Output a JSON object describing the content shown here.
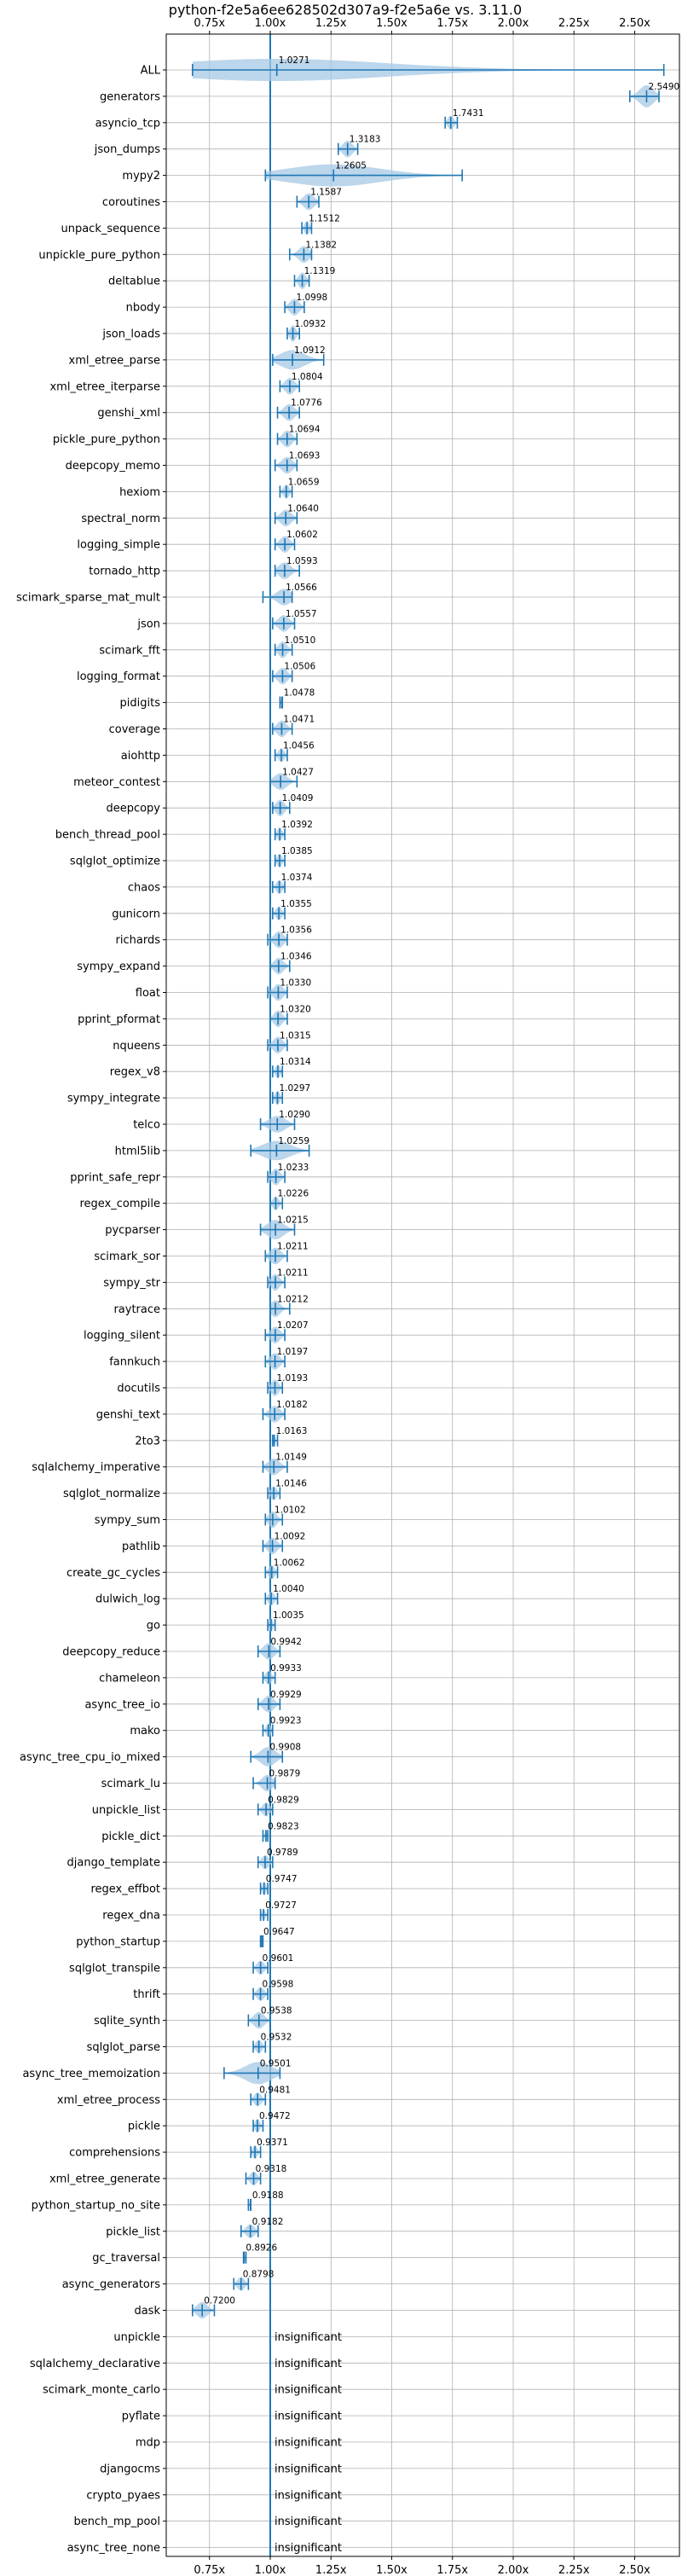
{
  "chart_data": {
    "type": "violin",
    "title": "python-f2e5a6ee628502d307a9-f2e5a6e vs. 3.11.0",
    "xlim": [
      0.6,
      2.75
    ],
    "xticks": [
      0.75,
      1.0,
      1.25,
      1.5,
      1.75,
      2.0,
      2.25,
      2.5
    ],
    "xtick_labels": [
      "0.75x",
      "1.00x",
      "1.25x",
      "1.50x",
      "1.75x",
      "2.00x",
      "2.25x",
      "2.50x"
    ],
    "grid": true,
    "reference_line": 1.0,
    "significant": [
      {
        "name": "ALL",
        "mean": 1.0271,
        "min": 0.68,
        "max": 2.62,
        "spread": 0.06
      },
      {
        "name": "generators",
        "mean": 2.549,
        "min": 2.48,
        "max": 2.6,
        "spread": 0.05
      },
      {
        "name": "asyncio_tcp",
        "mean": 1.7431,
        "min": 1.72,
        "max": 1.77,
        "spread": 0.02
      },
      {
        "name": "json_dumps",
        "mean": 1.3183,
        "min": 1.28,
        "max": 1.36,
        "spread": 0.03
      },
      {
        "name": "mypy2",
        "mean": 1.2605,
        "min": 0.98,
        "max": 1.79,
        "spread": 0.12
      },
      {
        "name": "coroutines",
        "mean": 1.1587,
        "min": 1.11,
        "max": 1.2,
        "spread": 0.03
      },
      {
        "name": "unpack_sequence",
        "mean": 1.1512,
        "min": 1.13,
        "max": 1.17,
        "spread": 0.02
      },
      {
        "name": "unpickle_pure_python",
        "mean": 1.1382,
        "min": 1.08,
        "max": 1.17,
        "spread": 0.03
      },
      {
        "name": "deltablue",
        "mean": 1.1319,
        "min": 1.1,
        "max": 1.16,
        "spread": 0.03
      },
      {
        "name": "nbody",
        "mean": 1.0998,
        "min": 1.06,
        "max": 1.14,
        "spread": 0.03
      },
      {
        "name": "json_loads",
        "mean": 1.0932,
        "min": 1.07,
        "max": 1.12,
        "spread": 0.03
      },
      {
        "name": "xml_etree_parse",
        "mean": 1.0912,
        "min": 1.01,
        "max": 1.22,
        "spread": 0.04
      },
      {
        "name": "xml_etree_iterparse",
        "mean": 1.0804,
        "min": 1.04,
        "max": 1.12,
        "spread": 0.03
      },
      {
        "name": "genshi_xml",
        "mean": 1.0776,
        "min": 1.03,
        "max": 1.12,
        "spread": 0.03
      },
      {
        "name": "pickle_pure_python",
        "mean": 1.0694,
        "min": 1.03,
        "max": 1.11,
        "spread": 0.03
      },
      {
        "name": "deepcopy_memo",
        "mean": 1.0693,
        "min": 1.02,
        "max": 1.11,
        "spread": 0.03
      },
      {
        "name": "hexiom",
        "mean": 1.0659,
        "min": 1.04,
        "max": 1.09,
        "spread": 0.02
      },
      {
        "name": "spectral_norm",
        "mean": 1.064,
        "min": 1.02,
        "max": 1.11,
        "spread": 0.03
      },
      {
        "name": "logging_simple",
        "mean": 1.0602,
        "min": 1.02,
        "max": 1.1,
        "spread": 0.03
      },
      {
        "name": "tornado_http",
        "mean": 1.0593,
        "min": 1.02,
        "max": 1.12,
        "spread": 0.03
      },
      {
        "name": "scimark_sparse_mat_mult",
        "mean": 1.0566,
        "min": 0.97,
        "max": 1.09,
        "spread": 0.03
      },
      {
        "name": "json",
        "mean": 1.0557,
        "min": 1.01,
        "max": 1.1,
        "spread": 0.03
      },
      {
        "name": "scimark_fft",
        "mean": 1.051,
        "min": 1.02,
        "max": 1.09,
        "spread": 0.03
      },
      {
        "name": "logging_format",
        "mean": 1.0506,
        "min": 1.01,
        "max": 1.09,
        "spread": 0.03
      },
      {
        "name": "pidigits",
        "mean": 1.0478,
        "min": 1.04,
        "max": 1.05,
        "spread": 0.01
      },
      {
        "name": "coverage",
        "mean": 1.0471,
        "min": 1.01,
        "max": 1.09,
        "spread": 0.03
      },
      {
        "name": "aiohttp",
        "mean": 1.0456,
        "min": 1.02,
        "max": 1.07,
        "spread": 0.02
      },
      {
        "name": "meteor_contest",
        "mean": 1.0427,
        "min": 1.0,
        "max": 1.11,
        "spread": 0.03
      },
      {
        "name": "deepcopy",
        "mean": 1.0409,
        "min": 1.01,
        "max": 1.08,
        "spread": 0.03
      },
      {
        "name": "bench_thread_pool",
        "mean": 1.0392,
        "min": 1.02,
        "max": 1.06,
        "spread": 0.02
      },
      {
        "name": "sqlglot_optimize",
        "mean": 1.0385,
        "min": 1.02,
        "max": 1.06,
        "spread": 0.02
      },
      {
        "name": "chaos",
        "mean": 1.0374,
        "min": 1.01,
        "max": 1.06,
        "spread": 0.02
      },
      {
        "name": "gunicorn",
        "mean": 1.0355,
        "min": 1.01,
        "max": 1.06,
        "spread": 0.02
      },
      {
        "name": "richards",
        "mean": 1.0356,
        "min": 0.99,
        "max": 1.07,
        "spread": 0.03
      },
      {
        "name": "sympy_expand",
        "mean": 1.0346,
        "min": 1.0,
        "max": 1.08,
        "spread": 0.03
      },
      {
        "name": "float",
        "mean": 1.033,
        "min": 0.99,
        "max": 1.07,
        "spread": 0.03
      },
      {
        "name": "pprint_pformat",
        "mean": 1.032,
        "min": 1.0,
        "max": 1.07,
        "spread": 0.03
      },
      {
        "name": "nqueens",
        "mean": 1.0315,
        "min": 0.99,
        "max": 1.07,
        "spread": 0.03
      },
      {
        "name": "regex_v8",
        "mean": 1.0314,
        "min": 1.01,
        "max": 1.05,
        "spread": 0.02
      },
      {
        "name": "sympy_integrate",
        "mean": 1.0297,
        "min": 1.01,
        "max": 1.05,
        "spread": 0.02
      },
      {
        "name": "telco",
        "mean": 1.029,
        "min": 0.96,
        "max": 1.1,
        "spread": 0.03
      },
      {
        "name": "html5lib",
        "mean": 1.0259,
        "min": 0.92,
        "max": 1.16,
        "spread": 0.04
      },
      {
        "name": "pprint_safe_repr",
        "mean": 1.0233,
        "min": 0.99,
        "max": 1.06,
        "spread": 0.03
      },
      {
        "name": "regex_compile",
        "mean": 1.0226,
        "min": 1.0,
        "max": 1.05,
        "spread": 0.02
      },
      {
        "name": "pycparser",
        "mean": 1.0215,
        "min": 0.96,
        "max": 1.1,
        "spread": 0.04
      },
      {
        "name": "scimark_sor",
        "mean": 1.0211,
        "min": 0.98,
        "max": 1.07,
        "spread": 0.03
      },
      {
        "name": "sympy_str",
        "mean": 1.0211,
        "min": 0.99,
        "max": 1.06,
        "spread": 0.03
      },
      {
        "name": "raytrace",
        "mean": 1.0212,
        "min": 1.0,
        "max": 1.08,
        "spread": 0.03
      },
      {
        "name": "logging_silent",
        "mean": 1.0207,
        "min": 0.98,
        "max": 1.06,
        "spread": 0.03
      },
      {
        "name": "fannkuch",
        "mean": 1.0197,
        "min": 0.98,
        "max": 1.06,
        "spread": 0.03
      },
      {
        "name": "docutils",
        "mean": 1.0193,
        "min": 0.99,
        "max": 1.05,
        "spread": 0.03
      },
      {
        "name": "genshi_text",
        "mean": 1.0182,
        "min": 0.97,
        "max": 1.06,
        "spread": 0.03
      },
      {
        "name": "2to3",
        "mean": 1.0163,
        "min": 1.01,
        "max": 1.03,
        "spread": 0.01
      },
      {
        "name": "sqlalchemy_imperative",
        "mean": 1.0149,
        "min": 0.97,
        "max": 1.07,
        "spread": 0.03
      },
      {
        "name": "sqlglot_normalize",
        "mean": 1.0146,
        "min": 0.99,
        "max": 1.04,
        "spread": 0.02
      },
      {
        "name": "sympy_sum",
        "mean": 1.0102,
        "min": 0.98,
        "max": 1.05,
        "spread": 0.03
      },
      {
        "name": "pathlib",
        "mean": 1.0092,
        "min": 0.97,
        "max": 1.05,
        "spread": 0.03
      },
      {
        "name": "create_gc_cycles",
        "mean": 1.0062,
        "min": 0.98,
        "max": 1.03,
        "spread": 0.02
      },
      {
        "name": "dulwich_log",
        "mean": 1.004,
        "min": 0.98,
        "max": 1.03,
        "spread": 0.02
      },
      {
        "name": "go",
        "mean": 1.0035,
        "min": 0.99,
        "max": 1.02,
        "spread": 0.02
      },
      {
        "name": "deepcopy_reduce",
        "mean": 0.9942,
        "min": 0.95,
        "max": 1.04,
        "spread": 0.03
      },
      {
        "name": "chameleon",
        "mean": 0.9933,
        "min": 0.97,
        "max": 1.02,
        "spread": 0.02
      },
      {
        "name": "async_tree_io",
        "mean": 0.9929,
        "min": 0.95,
        "max": 1.04,
        "spread": 0.03
      },
      {
        "name": "mako",
        "mean": 0.9923,
        "min": 0.97,
        "max": 1.01,
        "spread": 0.02
      },
      {
        "name": "async_tree_cpu_io_mixed",
        "mean": 0.9908,
        "min": 0.92,
        "max": 1.05,
        "spread": 0.04
      },
      {
        "name": "scimark_lu",
        "mean": 0.9879,
        "min": 0.93,
        "max": 1.02,
        "spread": 0.03
      },
      {
        "name": "unpickle_list",
        "mean": 0.9829,
        "min": 0.95,
        "max": 1.01,
        "spread": 0.02
      },
      {
        "name": "pickle_dict",
        "mean": 0.9823,
        "min": 0.97,
        "max": 0.99,
        "spread": 0.01
      },
      {
        "name": "django_template",
        "mean": 0.9789,
        "min": 0.95,
        "max": 1.01,
        "spread": 0.02
      },
      {
        "name": "regex_effbot",
        "mean": 0.9747,
        "min": 0.96,
        "max": 0.99,
        "spread": 0.02
      },
      {
        "name": "regex_dna",
        "mean": 0.9727,
        "min": 0.96,
        "max": 0.99,
        "spread": 0.01
      },
      {
        "name": "python_startup",
        "mean": 0.9647,
        "min": 0.96,
        "max": 0.97,
        "spread": 0.01
      },
      {
        "name": "sqlglot_transpile",
        "mean": 0.9601,
        "min": 0.93,
        "max": 0.99,
        "spread": 0.02
      },
      {
        "name": "thrift",
        "mean": 0.9598,
        "min": 0.93,
        "max": 0.99,
        "spread": 0.02
      },
      {
        "name": "sqlite_synth",
        "mean": 0.9538,
        "min": 0.91,
        "max": 1.0,
        "spread": 0.03
      },
      {
        "name": "sqlglot_parse",
        "mean": 0.9532,
        "min": 0.93,
        "max": 0.98,
        "spread": 0.02
      },
      {
        "name": "async_tree_memoization",
        "mean": 0.9501,
        "min": 0.81,
        "max": 1.04,
        "spread": 0.05
      },
      {
        "name": "xml_etree_process",
        "mean": 0.9481,
        "min": 0.92,
        "max": 0.98,
        "spread": 0.02
      },
      {
        "name": "pickle",
        "mean": 0.9472,
        "min": 0.93,
        "max": 0.97,
        "spread": 0.02
      },
      {
        "name": "comprehensions",
        "mean": 0.9371,
        "min": 0.92,
        "max": 0.96,
        "spread": 0.02
      },
      {
        "name": "xml_etree_generate",
        "mean": 0.9318,
        "min": 0.9,
        "max": 0.96,
        "spread": 0.02
      },
      {
        "name": "python_startup_no_site",
        "mean": 0.9188,
        "min": 0.91,
        "max": 0.92,
        "spread": 0.01
      },
      {
        "name": "pickle_list",
        "mean": 0.9182,
        "min": 0.88,
        "max": 0.95,
        "spread": 0.02
      },
      {
        "name": "gc_traversal",
        "mean": 0.8926,
        "min": 0.89,
        "max": 0.9,
        "spread": 0.01
      },
      {
        "name": "async_generators",
        "mean": 0.8798,
        "min": 0.85,
        "max": 0.91,
        "spread": 0.02
      },
      {
        "name": "dask",
        "mean": 0.72,
        "min": 0.68,
        "max": 0.77,
        "spread": 0.03
      }
    ],
    "mean_labels": [
      "1.0271",
      "2.5490",
      "1.7431",
      "1.3183",
      "1.2605",
      "1.1587",
      "1.1512",
      "1.1382",
      "1.1319",
      "1.0998",
      "1.0932",
      "1.0912",
      "1.0804",
      "1.0776",
      "1.0694",
      "1.0693",
      "1.0659",
      "1.0640",
      "1.0602",
      "1.0593",
      "1.0566",
      "1.0557",
      "1.0510",
      "1.0506",
      "1.0478",
      "1.0471",
      "1.0456",
      "1.0427",
      "1.0409",
      "1.0392",
      "1.0385",
      "1.0374",
      "1.0355",
      "1.0356",
      "1.0346",
      "1.0330",
      "1.0320",
      "1.0315",
      "1.0314",
      "1.0297",
      "1.0290",
      "1.0259",
      "1.0233",
      "1.0226",
      "1.0215",
      "1.0211",
      "1.0211",
      "1.0212",
      "1.0207",
      "1.0197",
      "1.0193",
      "1.0182",
      "1.0163",
      "1.0149",
      "1.0146",
      "1.0102",
      "1.0092",
      "1.0062",
      "1.0040",
      "1.0035",
      "0.9942",
      "0.9933",
      "0.9929",
      "0.9923",
      "0.9908",
      "0.9879",
      "0.9829",
      "0.9823",
      "0.9789",
      "0.9747",
      "0.9727",
      "0.9647",
      "0.9601",
      "0.9598",
      "0.9538",
      "0.9532",
      "0.9501",
      "0.9481",
      "0.9472",
      "0.9371",
      "0.9318",
      "0.9188",
      "0.9182",
      "0.8926",
      "0.8798",
      "0.7200"
    ],
    "insignificant": [
      "unpickle",
      "sqlalchemy_declarative",
      "scimark_monte_carlo",
      "pyflate",
      "mdp",
      "djangocms",
      "crypto_pyaes",
      "bench_mp_pool",
      "async_tree_none"
    ],
    "insignificant_label": "insignificant",
    "colors": {
      "series": "#1f77b4",
      "violin": "#a6c8e4",
      "grid": "#b0b0b0",
      "text": "#000000"
    }
  }
}
